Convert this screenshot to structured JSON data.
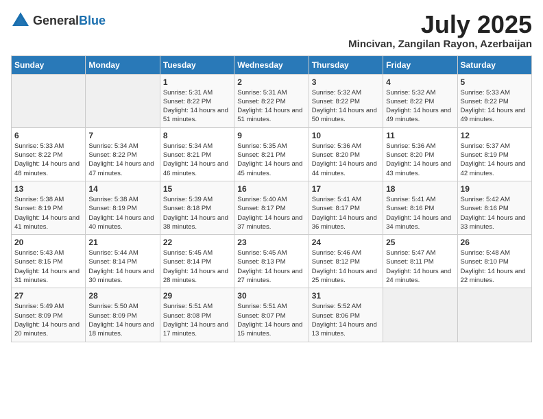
{
  "header": {
    "logo_general": "General",
    "logo_blue": "Blue",
    "month": "July 2025",
    "location": "Mincivan, Zangilan Rayon, Azerbaijan"
  },
  "weekdays": [
    "Sunday",
    "Monday",
    "Tuesday",
    "Wednesday",
    "Thursday",
    "Friday",
    "Saturday"
  ],
  "weeks": [
    [
      {
        "day": "",
        "sunrise": "",
        "sunset": "",
        "daylight": ""
      },
      {
        "day": "",
        "sunrise": "",
        "sunset": "",
        "daylight": ""
      },
      {
        "day": "1",
        "sunrise": "Sunrise: 5:31 AM",
        "sunset": "Sunset: 8:22 PM",
        "daylight": "Daylight: 14 hours and 51 minutes."
      },
      {
        "day": "2",
        "sunrise": "Sunrise: 5:31 AM",
        "sunset": "Sunset: 8:22 PM",
        "daylight": "Daylight: 14 hours and 51 minutes."
      },
      {
        "day": "3",
        "sunrise": "Sunrise: 5:32 AM",
        "sunset": "Sunset: 8:22 PM",
        "daylight": "Daylight: 14 hours and 50 minutes."
      },
      {
        "day": "4",
        "sunrise": "Sunrise: 5:32 AM",
        "sunset": "Sunset: 8:22 PM",
        "daylight": "Daylight: 14 hours and 49 minutes."
      },
      {
        "day": "5",
        "sunrise": "Sunrise: 5:33 AM",
        "sunset": "Sunset: 8:22 PM",
        "daylight": "Daylight: 14 hours and 49 minutes."
      }
    ],
    [
      {
        "day": "6",
        "sunrise": "Sunrise: 5:33 AM",
        "sunset": "Sunset: 8:22 PM",
        "daylight": "Daylight: 14 hours and 48 minutes."
      },
      {
        "day": "7",
        "sunrise": "Sunrise: 5:34 AM",
        "sunset": "Sunset: 8:22 PM",
        "daylight": "Daylight: 14 hours and 47 minutes."
      },
      {
        "day": "8",
        "sunrise": "Sunrise: 5:34 AM",
        "sunset": "Sunset: 8:21 PM",
        "daylight": "Daylight: 14 hours and 46 minutes."
      },
      {
        "day": "9",
        "sunrise": "Sunrise: 5:35 AM",
        "sunset": "Sunset: 8:21 PM",
        "daylight": "Daylight: 14 hours and 45 minutes."
      },
      {
        "day": "10",
        "sunrise": "Sunrise: 5:36 AM",
        "sunset": "Sunset: 8:20 PM",
        "daylight": "Daylight: 14 hours and 44 minutes."
      },
      {
        "day": "11",
        "sunrise": "Sunrise: 5:36 AM",
        "sunset": "Sunset: 8:20 PM",
        "daylight": "Daylight: 14 hours and 43 minutes."
      },
      {
        "day": "12",
        "sunrise": "Sunrise: 5:37 AM",
        "sunset": "Sunset: 8:19 PM",
        "daylight": "Daylight: 14 hours and 42 minutes."
      }
    ],
    [
      {
        "day": "13",
        "sunrise": "Sunrise: 5:38 AM",
        "sunset": "Sunset: 8:19 PM",
        "daylight": "Daylight: 14 hours and 41 minutes."
      },
      {
        "day": "14",
        "sunrise": "Sunrise: 5:38 AM",
        "sunset": "Sunset: 8:19 PM",
        "daylight": "Daylight: 14 hours and 40 minutes."
      },
      {
        "day": "15",
        "sunrise": "Sunrise: 5:39 AM",
        "sunset": "Sunset: 8:18 PM",
        "daylight": "Daylight: 14 hours and 38 minutes."
      },
      {
        "day": "16",
        "sunrise": "Sunrise: 5:40 AM",
        "sunset": "Sunset: 8:17 PM",
        "daylight": "Daylight: 14 hours and 37 minutes."
      },
      {
        "day": "17",
        "sunrise": "Sunrise: 5:41 AM",
        "sunset": "Sunset: 8:17 PM",
        "daylight": "Daylight: 14 hours and 36 minutes."
      },
      {
        "day": "18",
        "sunrise": "Sunrise: 5:41 AM",
        "sunset": "Sunset: 8:16 PM",
        "daylight": "Daylight: 14 hours and 34 minutes."
      },
      {
        "day": "19",
        "sunrise": "Sunrise: 5:42 AM",
        "sunset": "Sunset: 8:16 PM",
        "daylight": "Daylight: 14 hours and 33 minutes."
      }
    ],
    [
      {
        "day": "20",
        "sunrise": "Sunrise: 5:43 AM",
        "sunset": "Sunset: 8:15 PM",
        "daylight": "Daylight: 14 hours and 31 minutes."
      },
      {
        "day": "21",
        "sunrise": "Sunrise: 5:44 AM",
        "sunset": "Sunset: 8:14 PM",
        "daylight": "Daylight: 14 hours and 30 minutes."
      },
      {
        "day": "22",
        "sunrise": "Sunrise: 5:45 AM",
        "sunset": "Sunset: 8:14 PM",
        "daylight": "Daylight: 14 hours and 28 minutes."
      },
      {
        "day": "23",
        "sunrise": "Sunrise: 5:45 AM",
        "sunset": "Sunset: 8:13 PM",
        "daylight": "Daylight: 14 hours and 27 minutes."
      },
      {
        "day": "24",
        "sunrise": "Sunrise: 5:46 AM",
        "sunset": "Sunset: 8:12 PM",
        "daylight": "Daylight: 14 hours and 25 minutes."
      },
      {
        "day": "25",
        "sunrise": "Sunrise: 5:47 AM",
        "sunset": "Sunset: 8:11 PM",
        "daylight": "Daylight: 14 hours and 24 minutes."
      },
      {
        "day": "26",
        "sunrise": "Sunrise: 5:48 AM",
        "sunset": "Sunset: 8:10 PM",
        "daylight": "Daylight: 14 hours and 22 minutes."
      }
    ],
    [
      {
        "day": "27",
        "sunrise": "Sunrise: 5:49 AM",
        "sunset": "Sunset: 8:09 PM",
        "daylight": "Daylight: 14 hours and 20 minutes."
      },
      {
        "day": "28",
        "sunrise": "Sunrise: 5:50 AM",
        "sunset": "Sunset: 8:09 PM",
        "daylight": "Daylight: 14 hours and 18 minutes."
      },
      {
        "day": "29",
        "sunrise": "Sunrise: 5:51 AM",
        "sunset": "Sunset: 8:08 PM",
        "daylight": "Daylight: 14 hours and 17 minutes."
      },
      {
        "day": "30",
        "sunrise": "Sunrise: 5:51 AM",
        "sunset": "Sunset: 8:07 PM",
        "daylight": "Daylight: 14 hours and 15 minutes."
      },
      {
        "day": "31",
        "sunrise": "Sunrise: 5:52 AM",
        "sunset": "Sunset: 8:06 PM",
        "daylight": "Daylight: 14 hours and 13 minutes."
      },
      {
        "day": "",
        "sunrise": "",
        "sunset": "",
        "daylight": ""
      },
      {
        "day": "",
        "sunrise": "",
        "sunset": "",
        "daylight": ""
      }
    ]
  ]
}
